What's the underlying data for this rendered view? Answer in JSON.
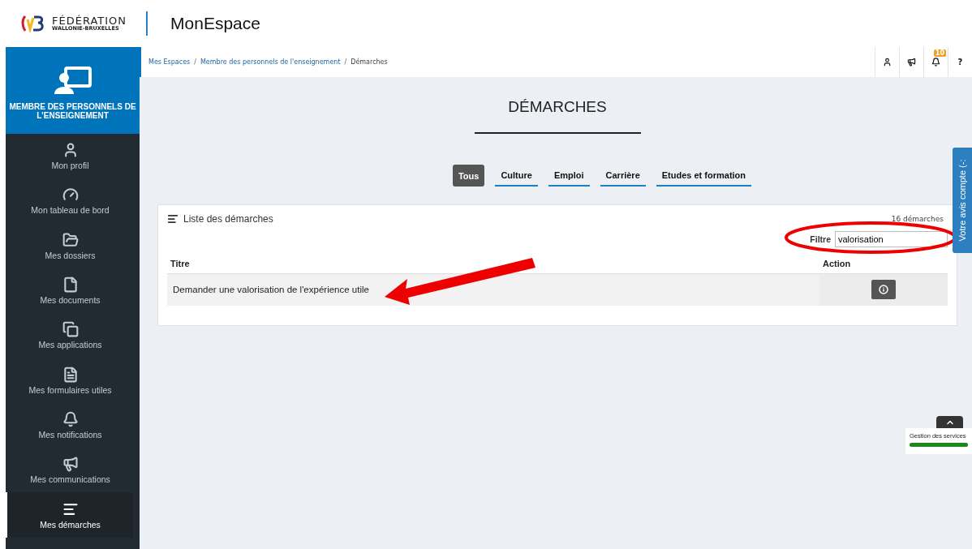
{
  "header": {
    "logo_title": "FÉDÉRATION",
    "logo_subtitle": "WALLONIE-BRUXELLES",
    "app_title": "MonEspace"
  },
  "sidebar": {
    "space_title": "MEMBRE DES PERSONNELS DE L'ENSEIGNEMENT",
    "items": [
      {
        "label": "Mon profil",
        "selected": false
      },
      {
        "label": "Mon tableau de bord",
        "selected": false
      },
      {
        "label": "Mes dossiers",
        "selected": false
      },
      {
        "label": "Mes documents",
        "selected": false
      },
      {
        "label": "Mes applications",
        "selected": false
      },
      {
        "label": "Mes formulaires utiles",
        "selected": false
      },
      {
        "label": "Mes notifications",
        "selected": false
      },
      {
        "label": "Mes communications",
        "selected": false
      },
      {
        "label": "Mes démarches",
        "selected": true
      }
    ]
  },
  "breadcrumb": {
    "separator": "/",
    "items": [
      "Mes Espaces",
      "Membre des personnels de l'enseignement",
      "Démarches"
    ]
  },
  "toolbar": [
    {
      "kind": "user"
    },
    {
      "kind": "megaphone"
    },
    {
      "kind": "bell",
      "badge": "10"
    },
    {
      "kind": "help",
      "label": "?"
    }
  ],
  "page_title": "DÉMARCHES",
  "tabs": [
    {
      "label": "Tous",
      "selected": true
    },
    {
      "label": "Culture",
      "selected": false
    },
    {
      "label": "Emploi",
      "selected": false
    },
    {
      "label": "Carrière",
      "selected": false
    },
    {
      "label": "Etudes et formation",
      "selected": false
    }
  ],
  "list": {
    "title": "Liste des démarches",
    "count": "16 démarches",
    "filter": {
      "label": "Filtre",
      "value": "valorisation"
    },
    "columns": [
      "Titre",
      "Action"
    ],
    "rows": [
      {
        "title": "Demander une valorisation de l'expérience utile"
      }
    ]
  },
  "feedback_tab": "Votre avis compte (-:",
  "service_status": {
    "label": "Gestion des services",
    "level": 1
  }
}
